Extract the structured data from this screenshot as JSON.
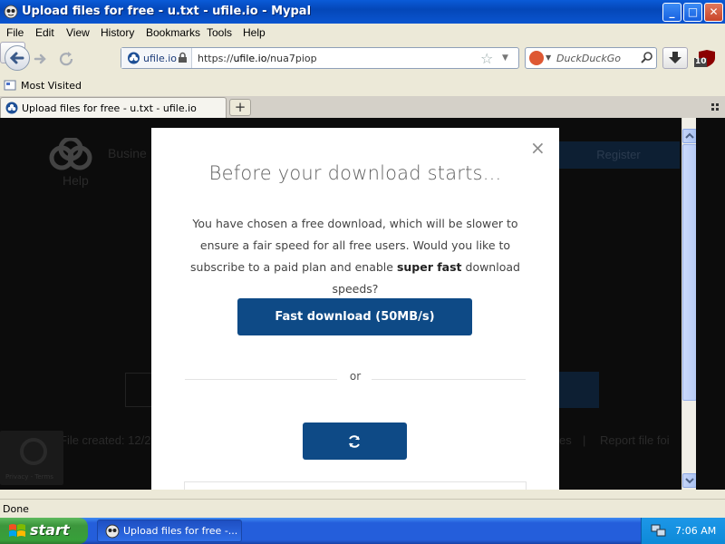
{
  "window": {
    "title": "Upload files for free - u.txt - ufile.io - Mypal",
    "min_label": "_",
    "max_label": "□",
    "close_label": "✕"
  },
  "menu": [
    "File",
    "Edit",
    "View",
    "History",
    "Bookmarks",
    "Tools",
    "Help"
  ],
  "navbar": {
    "site_identity": "ufile.io",
    "url_prefix": "https://",
    "url_domain": "ufile.io",
    "url_path": "/nua7piop",
    "search_placeholder": "DuckDuckGo",
    "ublock_count": "10"
  },
  "bookmarks": {
    "most_visited": "Most Visited"
  },
  "tabs": [
    {
      "label": "Upload files for free - u.txt - ufile.io",
      "active": true
    }
  ],
  "background_page": {
    "nav_business": "Busine",
    "nav_help": "Help",
    "register": "Register",
    "file_created": "File created: 12/2",
    "es_fragment": "es",
    "pipe": "|",
    "report": "Report file foi",
    "recaptcha_text": "Privacy - Terms"
  },
  "modal": {
    "close": "×",
    "title": "Before your download starts...",
    "body_before": "You have chosen a free download, which will be slower to ensure a fair speed for all free users. Would you like to subscribe to a paid plan and enable ",
    "body_bold": "super fast",
    "body_after": " download speeds?",
    "fast_button": "Fast download (50MB/s)",
    "or": "or"
  },
  "statusbar": {
    "text": "Done"
  },
  "taskbar": {
    "start": "start",
    "task_label": "Upload files for free -...",
    "clock": "7:06 AM"
  },
  "colors": {
    "modal_button": "#0e4a86",
    "xp_title": "#0a55d0",
    "xp_start": "#3c963c"
  }
}
